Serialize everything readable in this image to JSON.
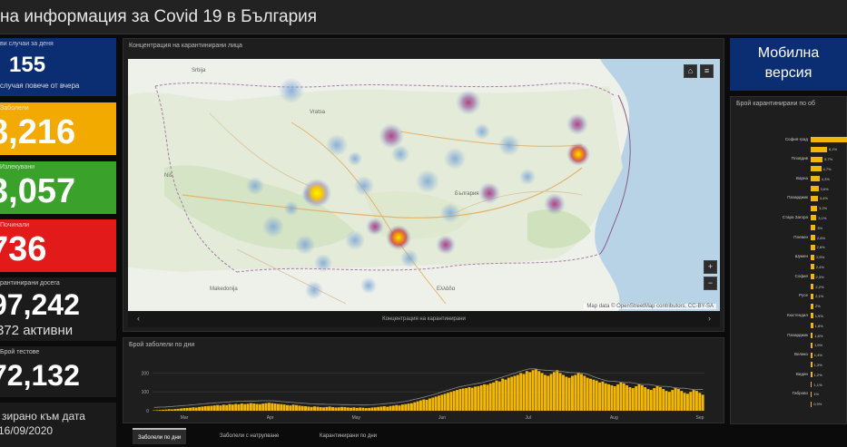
{
  "header": {
    "title": "на информация за Covid 19 в България"
  },
  "stats": {
    "new_cases": {
      "label": "ви случаи за деня",
      "value": "155",
      "sub": "случая повече от вчера",
      "color": "#0b2d72"
    },
    "infected": {
      "label": "Заболели",
      "value": "8,216",
      "color": "#f2a900"
    },
    "recovered": {
      "label": "Излекувани",
      "value": "3,057",
      "color": "#3aa12a"
    },
    "deaths": {
      "label": "Починали",
      "value": "736",
      "color": "#e31a1a"
    },
    "quarantined": {
      "label": "рантинирани досега",
      "value": "97,242",
      "sub": "372 активни"
    },
    "tests": {
      "label": "Брой тестове",
      "value": "72,132"
    },
    "updated": {
      "line1": "зирано към дата",
      "line2": "16/09/2020"
    }
  },
  "map_panel": {
    "title": "Концентрация на карантинирани лица",
    "attribution": "Map data © OpenStreetMap contributors, CC-BY-SA",
    "footer_caption": "Концентрация на карантинирани",
    "home_icon": "home-icon",
    "list_icon": "list-icon",
    "zoom_in": "+",
    "zoom_out": "−",
    "prev": "‹",
    "next": "›"
  },
  "daily_panel": {
    "title": "Брой заболели по дни",
    "y_ticks": [
      "200",
      "100",
      "0"
    ],
    "months": [
      "Mar",
      "Apr",
      "May",
      "Jun",
      "Jul",
      "Aug",
      "Sep"
    ]
  },
  "tabs": [
    {
      "label": "Заболели по дни",
      "active": true
    },
    {
      "label": "Заболели с натрупване",
      "active": false
    },
    {
      "label": "Карантинирани по дни",
      "active": false
    }
  ],
  "mobile": {
    "line1": "Мобилна",
    "line2": "версия"
  },
  "quarantine_panel": {
    "title": "Брой карантинирани по об"
  },
  "colors": {
    "accent_yellow": "#f2b705",
    "panel_bg": "#1e1e1e",
    "page_bg": "#0b0b0b"
  },
  "chart_data": [
    {
      "type": "bar",
      "title": "Брой заболели по дни",
      "x_range": [
        "Mar",
        "Sep"
      ],
      "ylim": [
        0,
        250
      ],
      "y_ticks": [
        0,
        100,
        200
      ],
      "months": [
        "Mar",
        "Apr",
        "May",
        "Jun",
        "Jul",
        "Aug",
        "Sep"
      ],
      "values": [
        2,
        3,
        4,
        5,
        6,
        8,
        7,
        9,
        10,
        12,
        14,
        15,
        16,
        18,
        17,
        20,
        22,
        24,
        25,
        26,
        28,
        30,
        28,
        32,
        30,
        35,
        33,
        36,
        34,
        38,
        35,
        37,
        40,
        38,
        36,
        35,
        38,
        40,
        42,
        40,
        38,
        36,
        35,
        33,
        30,
        28,
        32,
        30,
        27,
        25,
        24,
        22,
        20,
        23,
        21,
        19,
        18,
        20,
        22,
        19,
        17,
        18,
        20,
        19,
        17,
        16,
        18,
        15,
        17,
        16,
        14,
        15,
        17,
        18,
        20,
        22,
        24,
        21,
        25,
        27,
        30,
        28,
        33,
        35,
        38,
        40,
        45,
        50,
        55,
        60,
        58,
        65,
        70,
        75,
        80,
        85,
        90,
        95,
        100,
        105,
        110,
        115,
        118,
        120,
        125,
        122,
        128,
        130,
        135,
        140,
        138,
        145,
        150,
        160,
        155,
        170,
        165,
        175,
        180,
        185,
        190,
        200,
        195,
        210,
        205,
        215,
        220,
        210,
        200,
        190,
        185,
        195,
        205,
        215,
        200,
        190,
        180,
        175,
        185,
        190,
        200,
        195,
        185,
        175,
        170,
        165,
        160,
        150,
        155,
        145,
        140,
        135,
        130,
        140,
        150,
        145,
        135,
        125,
        120,
        130,
        140,
        135,
        125,
        115,
        110,
        120,
        130,
        125,
        115,
        105,
        100,
        110,
        120,
        115,
        105,
        95,
        90,
        100,
        110,
        105,
        95,
        85
      ],
      "series_color": "#f2b705"
    },
    {
      "type": "bar",
      "orientation": "horizontal",
      "title": "Брой карантинирани по об",
      "categories": [
        "София-град",
        "",
        "Пловдив",
        "",
        "Варна",
        "",
        "Пазарджик",
        "",
        "Стара Загора",
        "",
        "Плевен",
        "",
        "Шумен",
        "",
        "София",
        "",
        "Русе",
        "",
        "Кюстендил",
        "",
        "Пазарджик",
        "",
        "Велико",
        "",
        "Видин",
        "",
        "Габрово",
        ""
      ],
      "values": [
        100,
        44,
        32,
        28,
        24,
        21,
        19,
        17,
        15,
        13,
        12,
        11,
        10,
        9,
        8.5,
        8,
        7.5,
        7,
        6.5,
        6,
        5.5,
        5,
        4.5,
        4,
        3.8,
        3.5,
        3.2,
        3
      ],
      "value_labels": [
        "",
        "6,1%",
        "5,7%",
        "4,7%",
        "4,3%",
        "3,6%",
        "3,4%",
        "3,2%",
        "3,1%",
        "3%",
        "2,8%",
        "2,6%",
        "2,5%",
        "2,4%",
        "2,3%",
        "2,2%",
        "2,1%",
        "2%",
        "1,9%",
        "1,8%",
        "1,6%",
        "1,5%",
        "1,4%",
        "1,3%",
        "1,2%",
        "1,1%",
        "1%",
        "0,9%"
      ],
      "series_color": "#f2b705"
    }
  ]
}
